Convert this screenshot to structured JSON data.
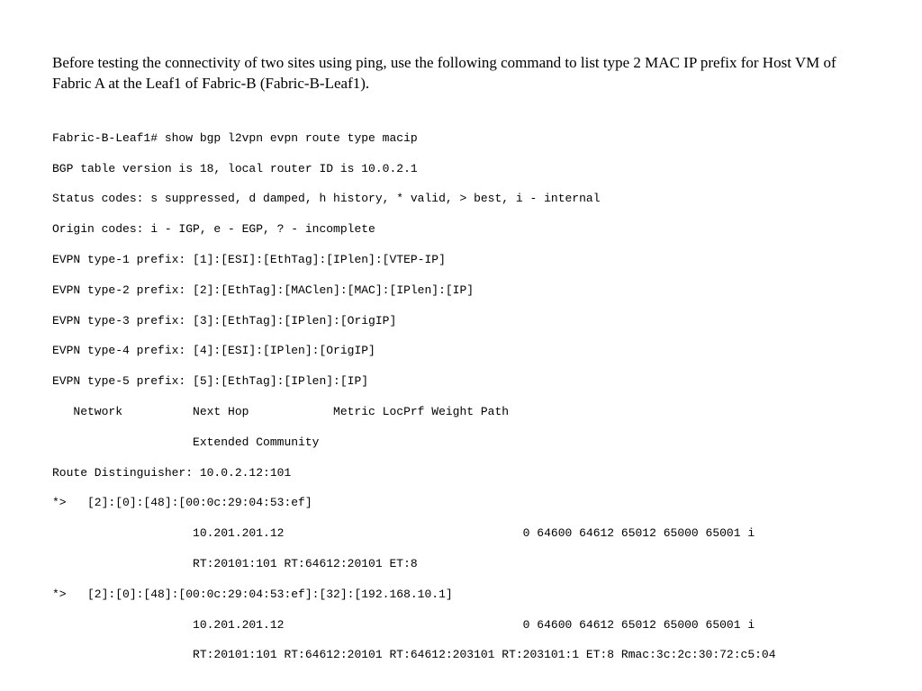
{
  "intro": "Before testing the connectivity of two sites using ping, use the following command to list type 2 MAC IP prefix for Host VM of Fabric A at the Leaf1 of Fabric-B (Fabric-B-Leaf1).",
  "terminal_lines": [
    "Fabric-B-Leaf1# show bgp l2vpn evpn route type macip",
    "BGP table version is 18, local router ID is 10.0.2.1",
    "Status codes: s suppressed, d damped, h history, * valid, > best, i - internal",
    "Origin codes: i - IGP, e - EGP, ? - incomplete",
    "EVPN type-1 prefix: [1]:[ESI]:[EthTag]:[IPlen]:[VTEP-IP]",
    "EVPN type-2 prefix: [2]:[EthTag]:[MAClen]:[MAC]:[IPlen]:[IP]",
    "EVPN type-3 prefix: [3]:[EthTag]:[IPlen]:[OrigIP]",
    "EVPN type-4 prefix: [4]:[ESI]:[IPlen]:[OrigIP]",
    "EVPN type-5 prefix: [5]:[EthTag]:[IPlen]:[IP]",
    "   Network          Next Hop            Metric LocPrf Weight Path",
    "                    Extended Community",
    "Route Distinguisher: 10.0.2.12:101",
    "*>   [2]:[0]:[48]:[00:0c:29:04:53:ef]",
    "                    10.201.201.12                                  0 64600 64612 65012 65000 65001 i",
    "                    RT:20101:101 RT:64612:20101 ET:8",
    "*>   [2]:[0]:[48]:[00:0c:29:04:53:ef]:[32]:[192.168.10.1]",
    "                    10.201.201.12                                  0 64600 64612 65012 65000 65001 i",
    "                    RT:20101:101 RT:64612:20101 RT:64612:203101 RT:203101:1 ET:8 Rmac:3c:2c:30:72:c5:04"
  ]
}
